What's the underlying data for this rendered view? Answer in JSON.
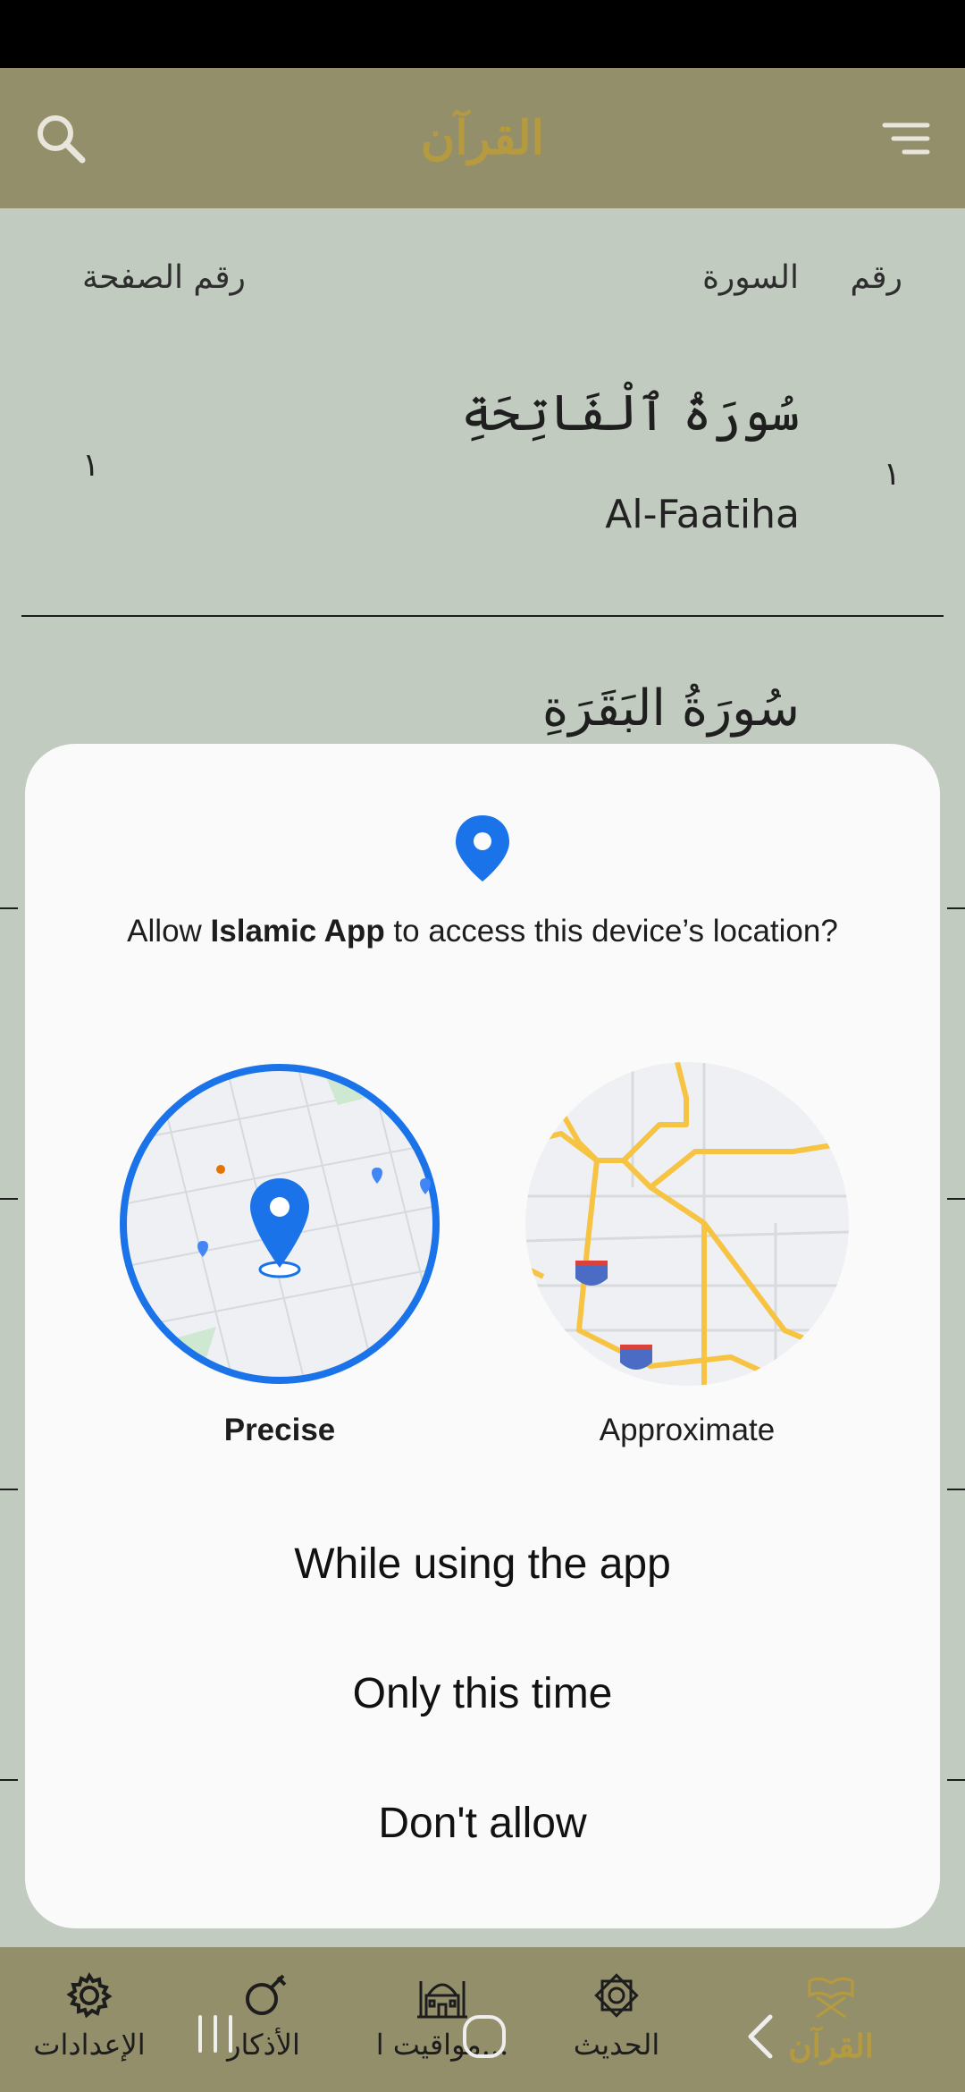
{
  "app_bar": {
    "title": "القرآن",
    "search_icon": "search-icon",
    "menu_icon": "filter-menu-icon"
  },
  "columns": {
    "number": "رقم",
    "surah": "السورة",
    "page": "رقم الصفحة"
  },
  "surahs": [
    {
      "arabic": "سُورَةُ ٱلْفَاتِحَةِ",
      "latin": "Al-Faatiha",
      "number": "١",
      "page": "١"
    },
    {
      "arabic": "سُورَةُ البَقَرَةِ",
      "latin": "",
      "number": "",
      "page": ""
    }
  ],
  "dialog": {
    "title_prefix": "Allow ",
    "app_name": "Islamic App",
    "title_suffix": " to access this device’s location?",
    "precise_label": "Precise",
    "approximate_label": "Approximate",
    "while_using": "While using the app",
    "only_this_time": "Only this time",
    "dont_allow": "Don't allow",
    "accent_color": "#1a73e8"
  },
  "bottom_nav": [
    {
      "label": "الإعدادات",
      "icon": "gear-icon"
    },
    {
      "label": "الأذكار",
      "icon": "prayer-beads-icon"
    },
    {
      "label": "مواقيت ا...",
      "icon": "mosque-icon"
    },
    {
      "label": "الحديث",
      "icon": "octagram-icon"
    },
    {
      "label": "القرآن",
      "icon": "quran-stand-icon",
      "active": true
    }
  ],
  "colors": {
    "app_bar": "#948f6b",
    "accent_gold": "#b59a3f",
    "background": "#c2cbc0"
  }
}
